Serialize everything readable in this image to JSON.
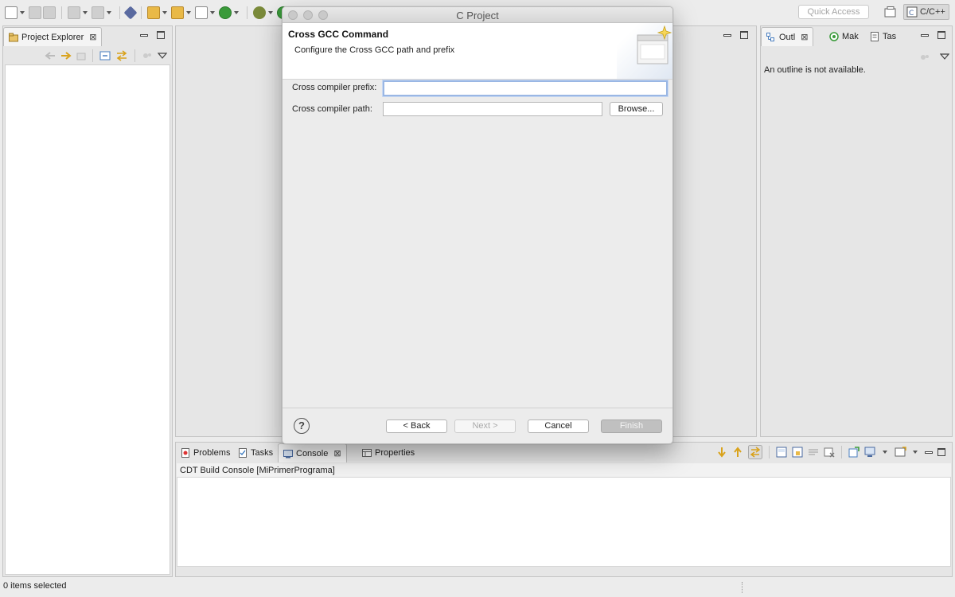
{
  "toolbar": {
    "quick_access_placeholder": "Quick Access",
    "perspective_label": "C/C++"
  },
  "project_explorer": {
    "tab_label": "Project Explorer",
    "close_glyph": "⊠"
  },
  "outline": {
    "tabs": [
      {
        "label": "Outl",
        "close_glyph": "⊠"
      },
      {
        "label": "Mak"
      },
      {
        "label": "Tas"
      }
    ],
    "message": "An outline is not available."
  },
  "console_panel": {
    "tabs": [
      {
        "label": "Problems"
      },
      {
        "label": "Tasks"
      },
      {
        "label": "Console",
        "close_glyph": "⊠"
      },
      {
        "label": "Properties"
      }
    ],
    "header_text": "CDT Build Console [MiPrimerPrograma]"
  },
  "status_bar": {
    "message": "0 items selected"
  },
  "dialog": {
    "window_title": "C Project",
    "page_title": "Cross GCC Command",
    "page_description": "Configure the Cross GCC path and prefix",
    "fields": {
      "prefix_label": "Cross compiler prefix:",
      "prefix_value": "",
      "path_label": "Cross compiler path:",
      "path_value": "",
      "browse_label": "Browse..."
    },
    "help_glyph": "?",
    "buttons": {
      "back": "< Back",
      "next": "Next >",
      "cancel": "Cancel",
      "finish": "Finish"
    }
  },
  "colors": {
    "focus_ring": "#9ab7e4",
    "finish_disabled_bg": "#c0c0c0",
    "window_bg": "#ececec"
  }
}
